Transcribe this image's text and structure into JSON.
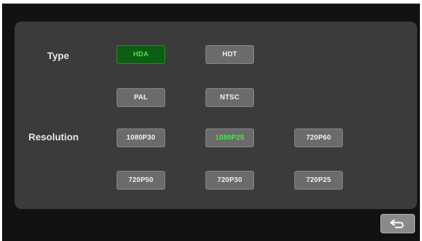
{
  "labels": {
    "type": "Type",
    "resolution": "Resolution"
  },
  "type_options": {
    "hda": "HDA",
    "hdt": "HDT",
    "pal": "PAL",
    "ntsc": "NTSC"
  },
  "resolution_options": {
    "r1080p30": "1080P30",
    "r1080p25": "1080P25",
    "r720p60": "720P60",
    "r720p50": "720P50",
    "r720p30": "720P30",
    "r720p25": "720P25"
  },
  "selected": {
    "type": "HDA",
    "resolution": "1080P25"
  },
  "icons": {
    "back": "return-arrow-icon"
  },
  "colors": {
    "screen_bg": "#121212",
    "panel_bg": "#3b3b3b",
    "button_bg": "#6b6b6b",
    "selected_bg": "#0c5e12",
    "selected_text": "#3bf03b"
  }
}
